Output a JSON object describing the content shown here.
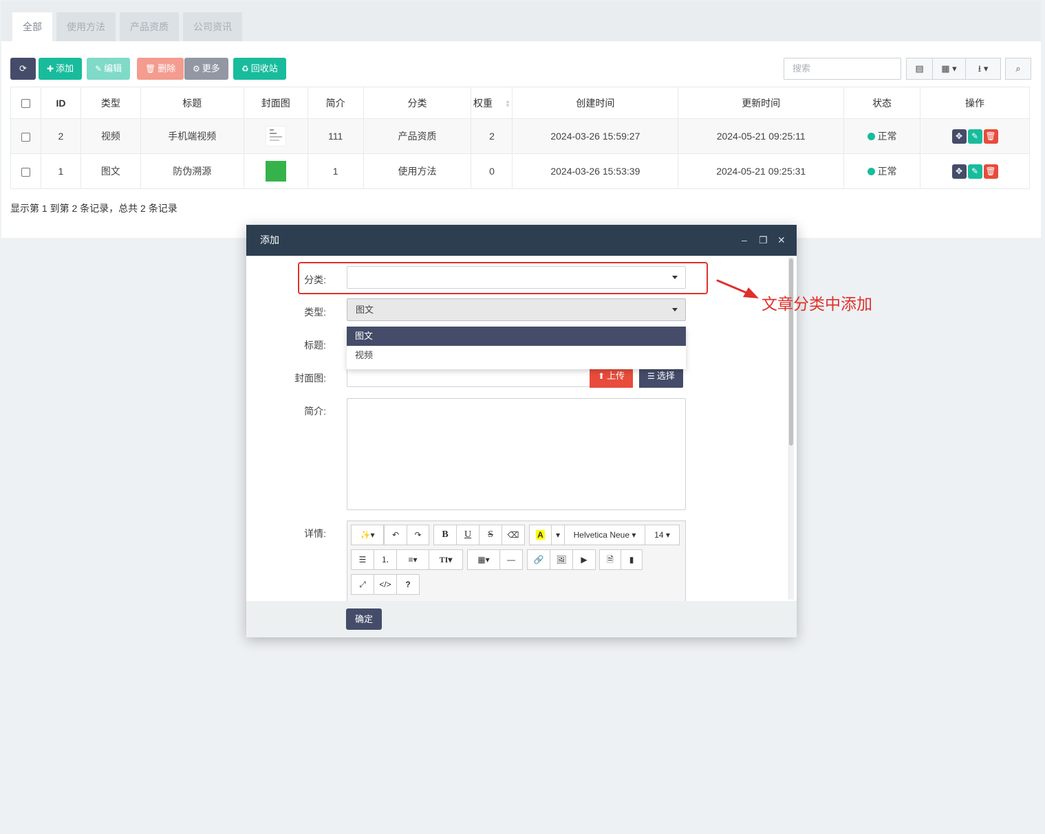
{
  "tabs": [
    {
      "label": "全部",
      "active": true
    },
    {
      "label": "使用方法",
      "active": false
    },
    {
      "label": "产品资质",
      "active": false
    },
    {
      "label": "公司资讯",
      "active": false
    }
  ],
  "toolbar": {
    "refresh_label": "",
    "add_label": "添加",
    "edit_label": "编辑",
    "delete_label": "删除",
    "more_label": "更多",
    "recycle_label": "回收站"
  },
  "search": {
    "placeholder": "搜索"
  },
  "table": {
    "headers": [
      "ID",
      "类型",
      "标题",
      "封面图",
      "简介",
      "分类",
      "权重",
      "创建时间",
      "更新时间",
      "状态",
      "操作"
    ],
    "rows": [
      {
        "id": "2",
        "type": "视频",
        "title": "手机端视频",
        "intro": "111",
        "category": "产品资质",
        "weight": "2",
        "created": "2024-03-26 15:59:27",
        "updated": "2024-05-21 09:25:11",
        "status": "正常"
      },
      {
        "id": "1",
        "type": "图文",
        "title": "防伪溯源",
        "intro": "1",
        "category": "使用方法",
        "weight": "0",
        "created": "2024-03-26 15:53:39",
        "updated": "2024-05-21 09:25:31",
        "status": "正常"
      }
    ]
  },
  "summary": "显示第 1 到第 2 条记录，总共 2 条记录",
  "modal": {
    "title": "添加",
    "labels": {
      "category": "分类:",
      "type": "类型:",
      "title": "标题:",
      "cover": "封面图:",
      "intro": "简介:",
      "detail": "详情:"
    },
    "category_value": "",
    "type_value": "图文",
    "type_options": [
      "图文",
      "视频"
    ],
    "upload_label": "上传",
    "choose_label": "选择",
    "font_name": "Helvetica Neue",
    "font_size": "14",
    "confirm_label": "确定"
  },
  "annotation": {
    "text": "文章分类中添加",
    "color": "#e0302a"
  },
  "colors": {
    "dark": "#444c69",
    "green": "#18bc9c",
    "red": "#e74c3c",
    "modal_header": "#2c3e50"
  }
}
